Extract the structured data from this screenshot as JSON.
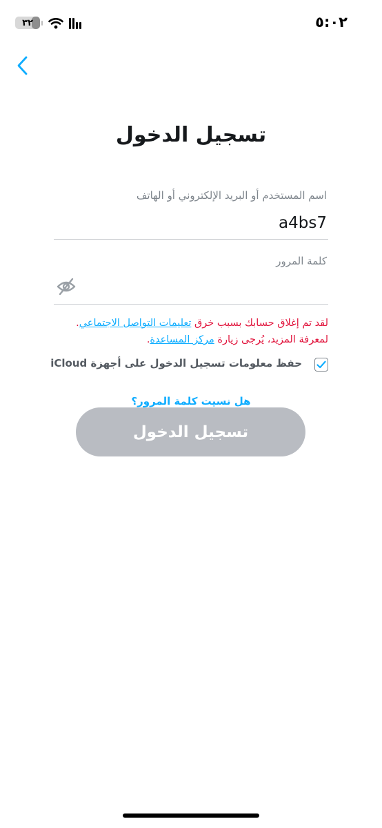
{
  "status_bar": {
    "time": "٥:٠٢",
    "battery": "٣٢",
    "battery_level": 0.32
  },
  "header": {
    "back_icon": "chevron-left-icon"
  },
  "title": "تسجيل الدخول",
  "username": {
    "label": "اسم المستخدم أو البريد الإلكتروني أو الهاتف",
    "value": "a4bs7"
  },
  "password": {
    "label": "كلمة المرور",
    "value": "",
    "toggle_icon": "eye-slash-icon"
  },
  "error": {
    "text_1": "لقد تم إغلاق حسابك بسبب خرق ",
    "link_1": "تعليمات التواصل الاجتماعي",
    "text_2": ". لمعرفة المزيد، يُرجى زيارة ",
    "link_2": "مركز المساعدة",
    "text_3": "."
  },
  "save_login": {
    "label": "حفظ معلومات تسجيل الدخول على أجهزة iCloud",
    "checked": true
  },
  "forgot_password": "هل نسيت كلمة المرور؟",
  "login_button": "تسجيل الدخول",
  "colors": {
    "accent": "#0fadff",
    "error": "#e1143c",
    "button_disabled": "#b9bcc2"
  }
}
